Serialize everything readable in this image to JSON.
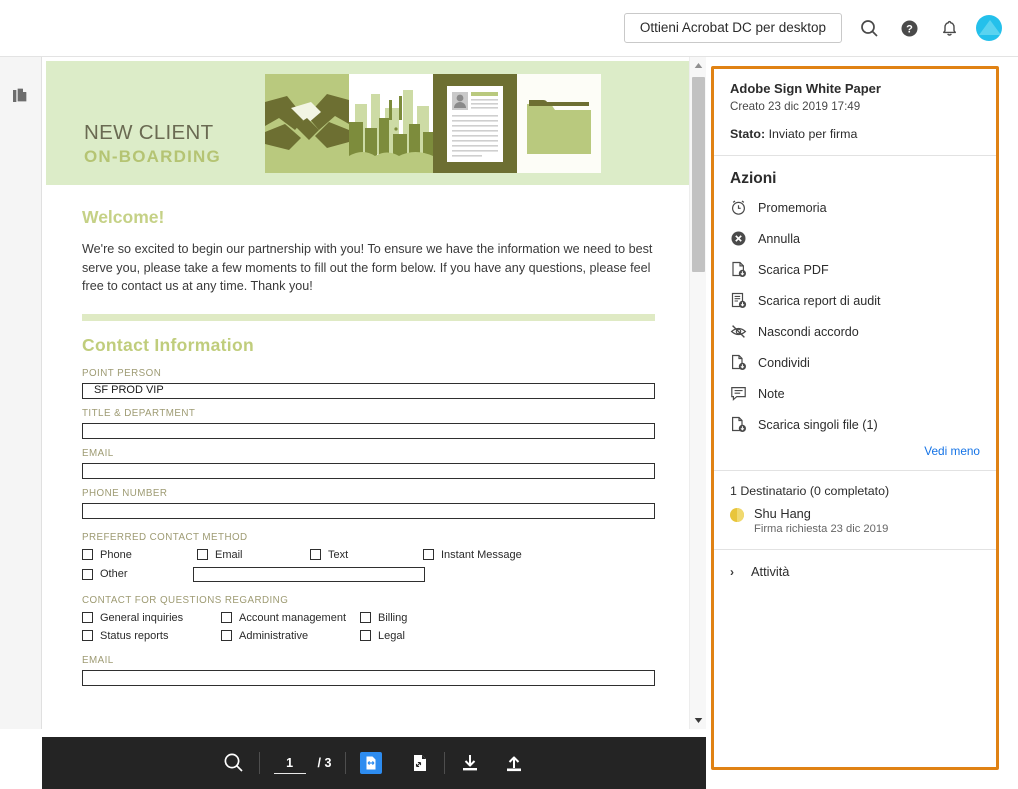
{
  "topbar": {
    "get_acrobat_label": "Ottieni Acrobat DC per desktop",
    "icons": [
      "search-icon",
      "help-icon",
      "notification-bell-icon",
      "user-avatar"
    ]
  },
  "left_rail": {
    "thumbnails_icon": "page-thumbnails-icon"
  },
  "document": {
    "banner": {
      "title_line1": "NEW CLIENT",
      "title_line2": "ON-BOARDING",
      "background_color": "#dcecc8",
      "panels": [
        "handshake-illustration",
        "cityscape-illustration",
        "resume-document-illustration",
        "folder-illustration"
      ]
    },
    "welcome_heading": "Welcome!",
    "welcome_paragraph": "We're so excited to begin our partnership with you! To ensure we have the information we need to best serve you, please take a few moments to fill out the form below. If you have any questions, please feel free to contact us at any time. Thank you!",
    "contact_heading": "Contact Information",
    "fields": [
      {
        "label": "POINT PERSON",
        "value": "SF PROD VIP"
      },
      {
        "label": "TITLE & DEPARTMENT",
        "value": ""
      },
      {
        "label": "EMAIL",
        "value": ""
      },
      {
        "label": "PHONE NUMBER",
        "value": ""
      }
    ],
    "preferred_contact_method": {
      "label": "PREFERRED CONTACT METHOD",
      "options": [
        "Phone",
        "Email",
        "Text",
        "Instant Message"
      ],
      "other_label": "Other",
      "other_value": ""
    },
    "contact_for_questions": {
      "label": "CONTACT FOR QUESTIONS REGARDING",
      "options": [
        "General inquiries",
        "Account management",
        "Billing",
        "Status reports",
        "Administrative",
        "Legal"
      ]
    },
    "bottom_email": {
      "label": "EMAIL",
      "value": ""
    },
    "heading_color": "#c0cd7c"
  },
  "toolbar": {
    "search_icon": "search-icon",
    "page_current": "1",
    "page_total": "/ 3",
    "fit_width_icon": "fit-width-icon",
    "fit_page_icon": "fit-page-icon",
    "download_icon": "download-icon",
    "upload_icon": "upload-icon",
    "accent_color": "#2d8cf0"
  },
  "panel": {
    "border_color": "#e08214",
    "agreement_title": "Adobe Sign White Paper",
    "created": "Creato 23 dic 2019 17:49",
    "status_label": "Stato:",
    "status_value": "Inviato per firma",
    "actions_heading": "Azioni",
    "actions": [
      {
        "label": "Promemoria",
        "icon": "alarm-clock-icon"
      },
      {
        "label": "Annulla",
        "icon": "cancel-circle-icon"
      },
      {
        "label": "Scarica PDF",
        "icon": "download-pdf-icon"
      },
      {
        "label": "Scarica report di audit",
        "icon": "download-audit-report-icon"
      },
      {
        "label": "Nascondi accordo",
        "icon": "hide-eye-icon"
      },
      {
        "label": "Condividi",
        "icon": "share-document-icon"
      },
      {
        "label": "Note",
        "icon": "comment-note-icon"
      },
      {
        "label": "Scarica singoli file (1)",
        "icon": "download-individual-files-icon"
      }
    ],
    "see_less": "Vedi meno",
    "see_less_color": "#1473e6",
    "recipients_heading": "1 Destinatario (0 completato)",
    "recipient_name": "Shu Hang",
    "recipient_status": "Firma richiesta 23 dic 2019",
    "recipient_dot_color": "#e8c53b",
    "activity_label": "Attività",
    "activity_chevron": "›"
  }
}
